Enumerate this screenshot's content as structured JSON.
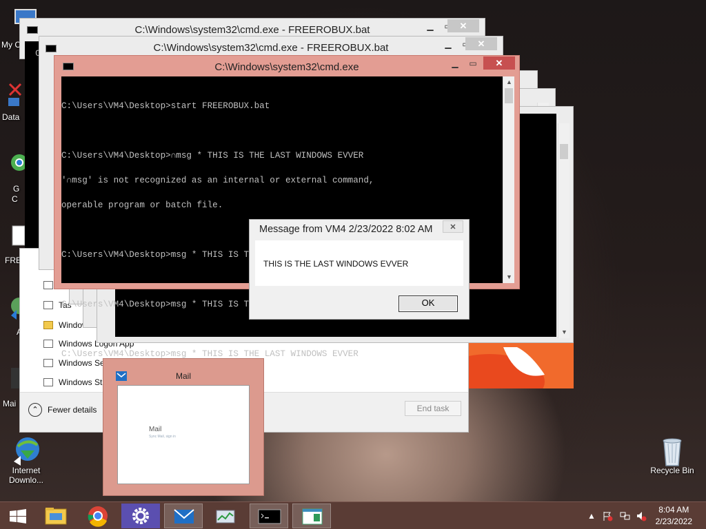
{
  "desktop": {
    "icons_left_partial": [
      "My C",
      "Data",
      "G",
      "C",
      "FRE",
      "A",
      "Mai"
    ],
    "idm": {
      "line1": "Internet",
      "line2": "Downlo..."
    },
    "recycle_bin": "Recycle Bin"
  },
  "cmd_back": {
    "title": "C:\\Windows\\system32\\cmd.exe - FREEROBUX.bat",
    "prompt_letter": "C"
  },
  "cmd_mid": {
    "title": "C:\\Windows\\system32\\cmd.exe - FREEROBUX.bat"
  },
  "cmd_front": {
    "title": "C:\\Windows\\system32\\cmd.exe",
    "lines": [
      "C:\\Users\\VM4\\Desktop>start FREEROBUX.bat",
      "",
      "C:\\Users\\VM4\\Desktop>∩msg * THIS IS THE LAST WINDOWS EVVER",
      "'∩msg' is not recognized as an internal or external command,",
      "operable program or batch file.",
      "",
      "C:\\Users\\VM4\\Desktop>msg * THIS IS THE LAST WINDOWS EVVER",
      "",
      "C:\\Users\\VM4\\Desktop>msg * THIS IS THE LAST WINDOWS EVVER",
      "",
      "C:\\Users\\VM4\\Desktop>msg * THIS IS THE LAST WINDOWS EVVER"
    ]
  },
  "task_manager": {
    "rows": [
      "",
      "Tas",
      "Windows Exp",
      "Windows Logon App",
      "Windows Se",
      "Windows Sta"
    ],
    "fewer_details": "Fewer details",
    "end_task": "End task"
  },
  "message": {
    "title": "Message from VM4 2/23/2022 8:02 AM",
    "body": "THIS IS THE LAST WINDOWS EVVER",
    "ok": "OK"
  },
  "mail_preview": {
    "title": "Mail",
    "inner_title": "Mail",
    "inner_sub": "Sync Mail, sign in"
  },
  "taskbar": {
    "items": [
      "start",
      "file-explorer",
      "chrome",
      "settings",
      "mail",
      "task-manager",
      "cmd",
      "notepad-app"
    ],
    "clock_time": "8:04 AM",
    "clock_date": "2/23/2022"
  },
  "colors": {
    "active_frame": "#e39d93",
    "close_red": "#c75050",
    "taskbar": "#5a3c35",
    "console_bg": "#000000",
    "console_fg": "#c0c0c0"
  }
}
